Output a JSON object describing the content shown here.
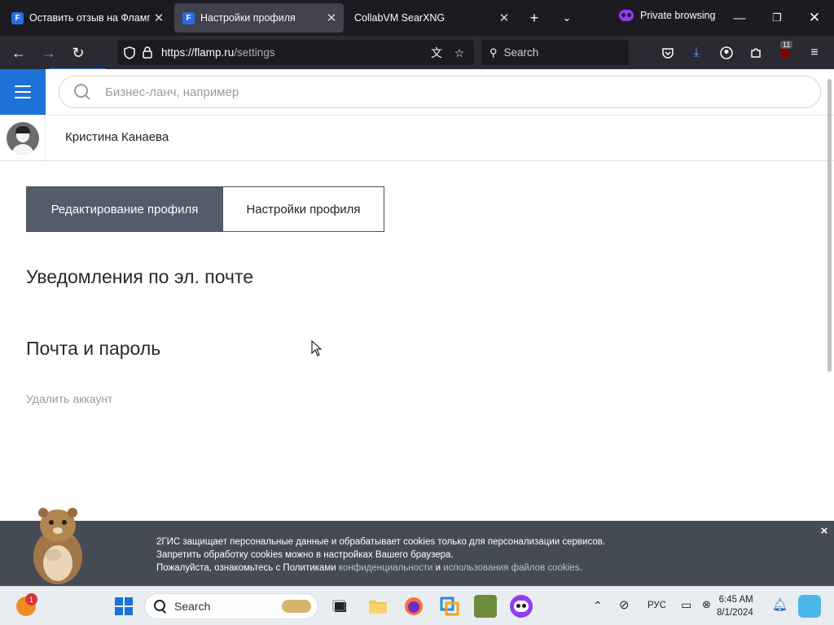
{
  "browser": {
    "tabs": [
      {
        "title": "Оставить отзыв на Флампе",
        "favicon": "F",
        "active": false
      },
      {
        "title": "Настройки профиля",
        "favicon": "F",
        "active": true
      },
      {
        "title": "CollabVM SearXNG",
        "favicon": "",
        "active": false
      }
    ],
    "private_label": "Private browsing",
    "url_host": "https://flamp.ru",
    "url_path": "/settings",
    "search_placeholder": "Search",
    "extensions_badge": "11",
    "icons": {
      "new_tab": "plus-icon",
      "tab_list": "chevron-down-icon",
      "minimize": "minimize-icon",
      "restore": "restore-icon",
      "close": "close-icon",
      "back": "arrow-left-icon",
      "forward": "arrow-right-icon",
      "reload": "reload-icon",
      "shield": "shield-icon",
      "lock": "lock-icon",
      "translate": "translate-icon",
      "bookmark": "star-icon",
      "pocket": "pocket-icon",
      "downloads": "download-icon",
      "account": "account-icon",
      "extensions": "puzzle-icon",
      "ublock": "ublock-icon",
      "menu": "hamburger-icon"
    }
  },
  "site": {
    "search_placeholder": "Бизнес-ланч, например",
    "user_name": "Кристина Канаева",
    "tabs": [
      {
        "label": "Редактирование профиля",
        "active": true
      },
      {
        "label": "Настройки профиля",
        "active": false
      }
    ],
    "section_email": "Уведомления по эл. почте",
    "section_password": "Почта и пароль",
    "delete_account": "Удалить аккаунт",
    "accent_color": "#1e73d8"
  },
  "cookie_banner": {
    "line1": "2ГИС защищает персональные данные и обрабатывает cookies только для персонализации сервисов.",
    "line2": "Запретить обработку cookies можно в настройках Вашего браузера.",
    "line3_prefix": "Пожалуйста, ознакомьтесь с Политиками",
    "link1": "конфиденциальности",
    "conj": "и",
    "link2": "использования файлов cookies",
    "line3_suffix": ".",
    "close": "×"
  },
  "taskbar": {
    "search_label": "Search",
    "notification_count": "1",
    "language": "РУС",
    "time": "6:45 AM",
    "date": "8/1/2024"
  }
}
